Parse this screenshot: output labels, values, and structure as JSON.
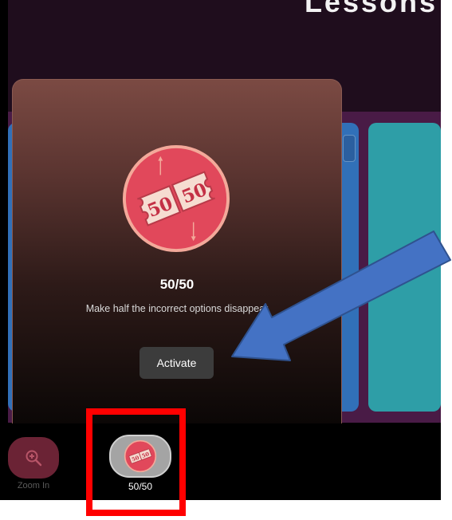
{
  "header": {
    "corner_text": "Lessons"
  },
  "popup": {
    "title": "50/50",
    "description": "Make half the incorrect options disappear",
    "activate_label": "Activate",
    "icon": "fifty-fifty-ticket-icon"
  },
  "powerups": [
    {
      "label": "Zoom In",
      "icon": "zoom-in-icon"
    },
    {
      "label": "50/50",
      "icon": "fifty-fifty-ticket-icon"
    }
  ],
  "colors": {
    "badge_red": "#e1485b",
    "badge_ring": "#f3a99a",
    "option_blue": "#3170b8",
    "option_teal": "#2e9ea7",
    "annotation_arrow": "#4472c4",
    "highlight_box": "#ff0000"
  }
}
